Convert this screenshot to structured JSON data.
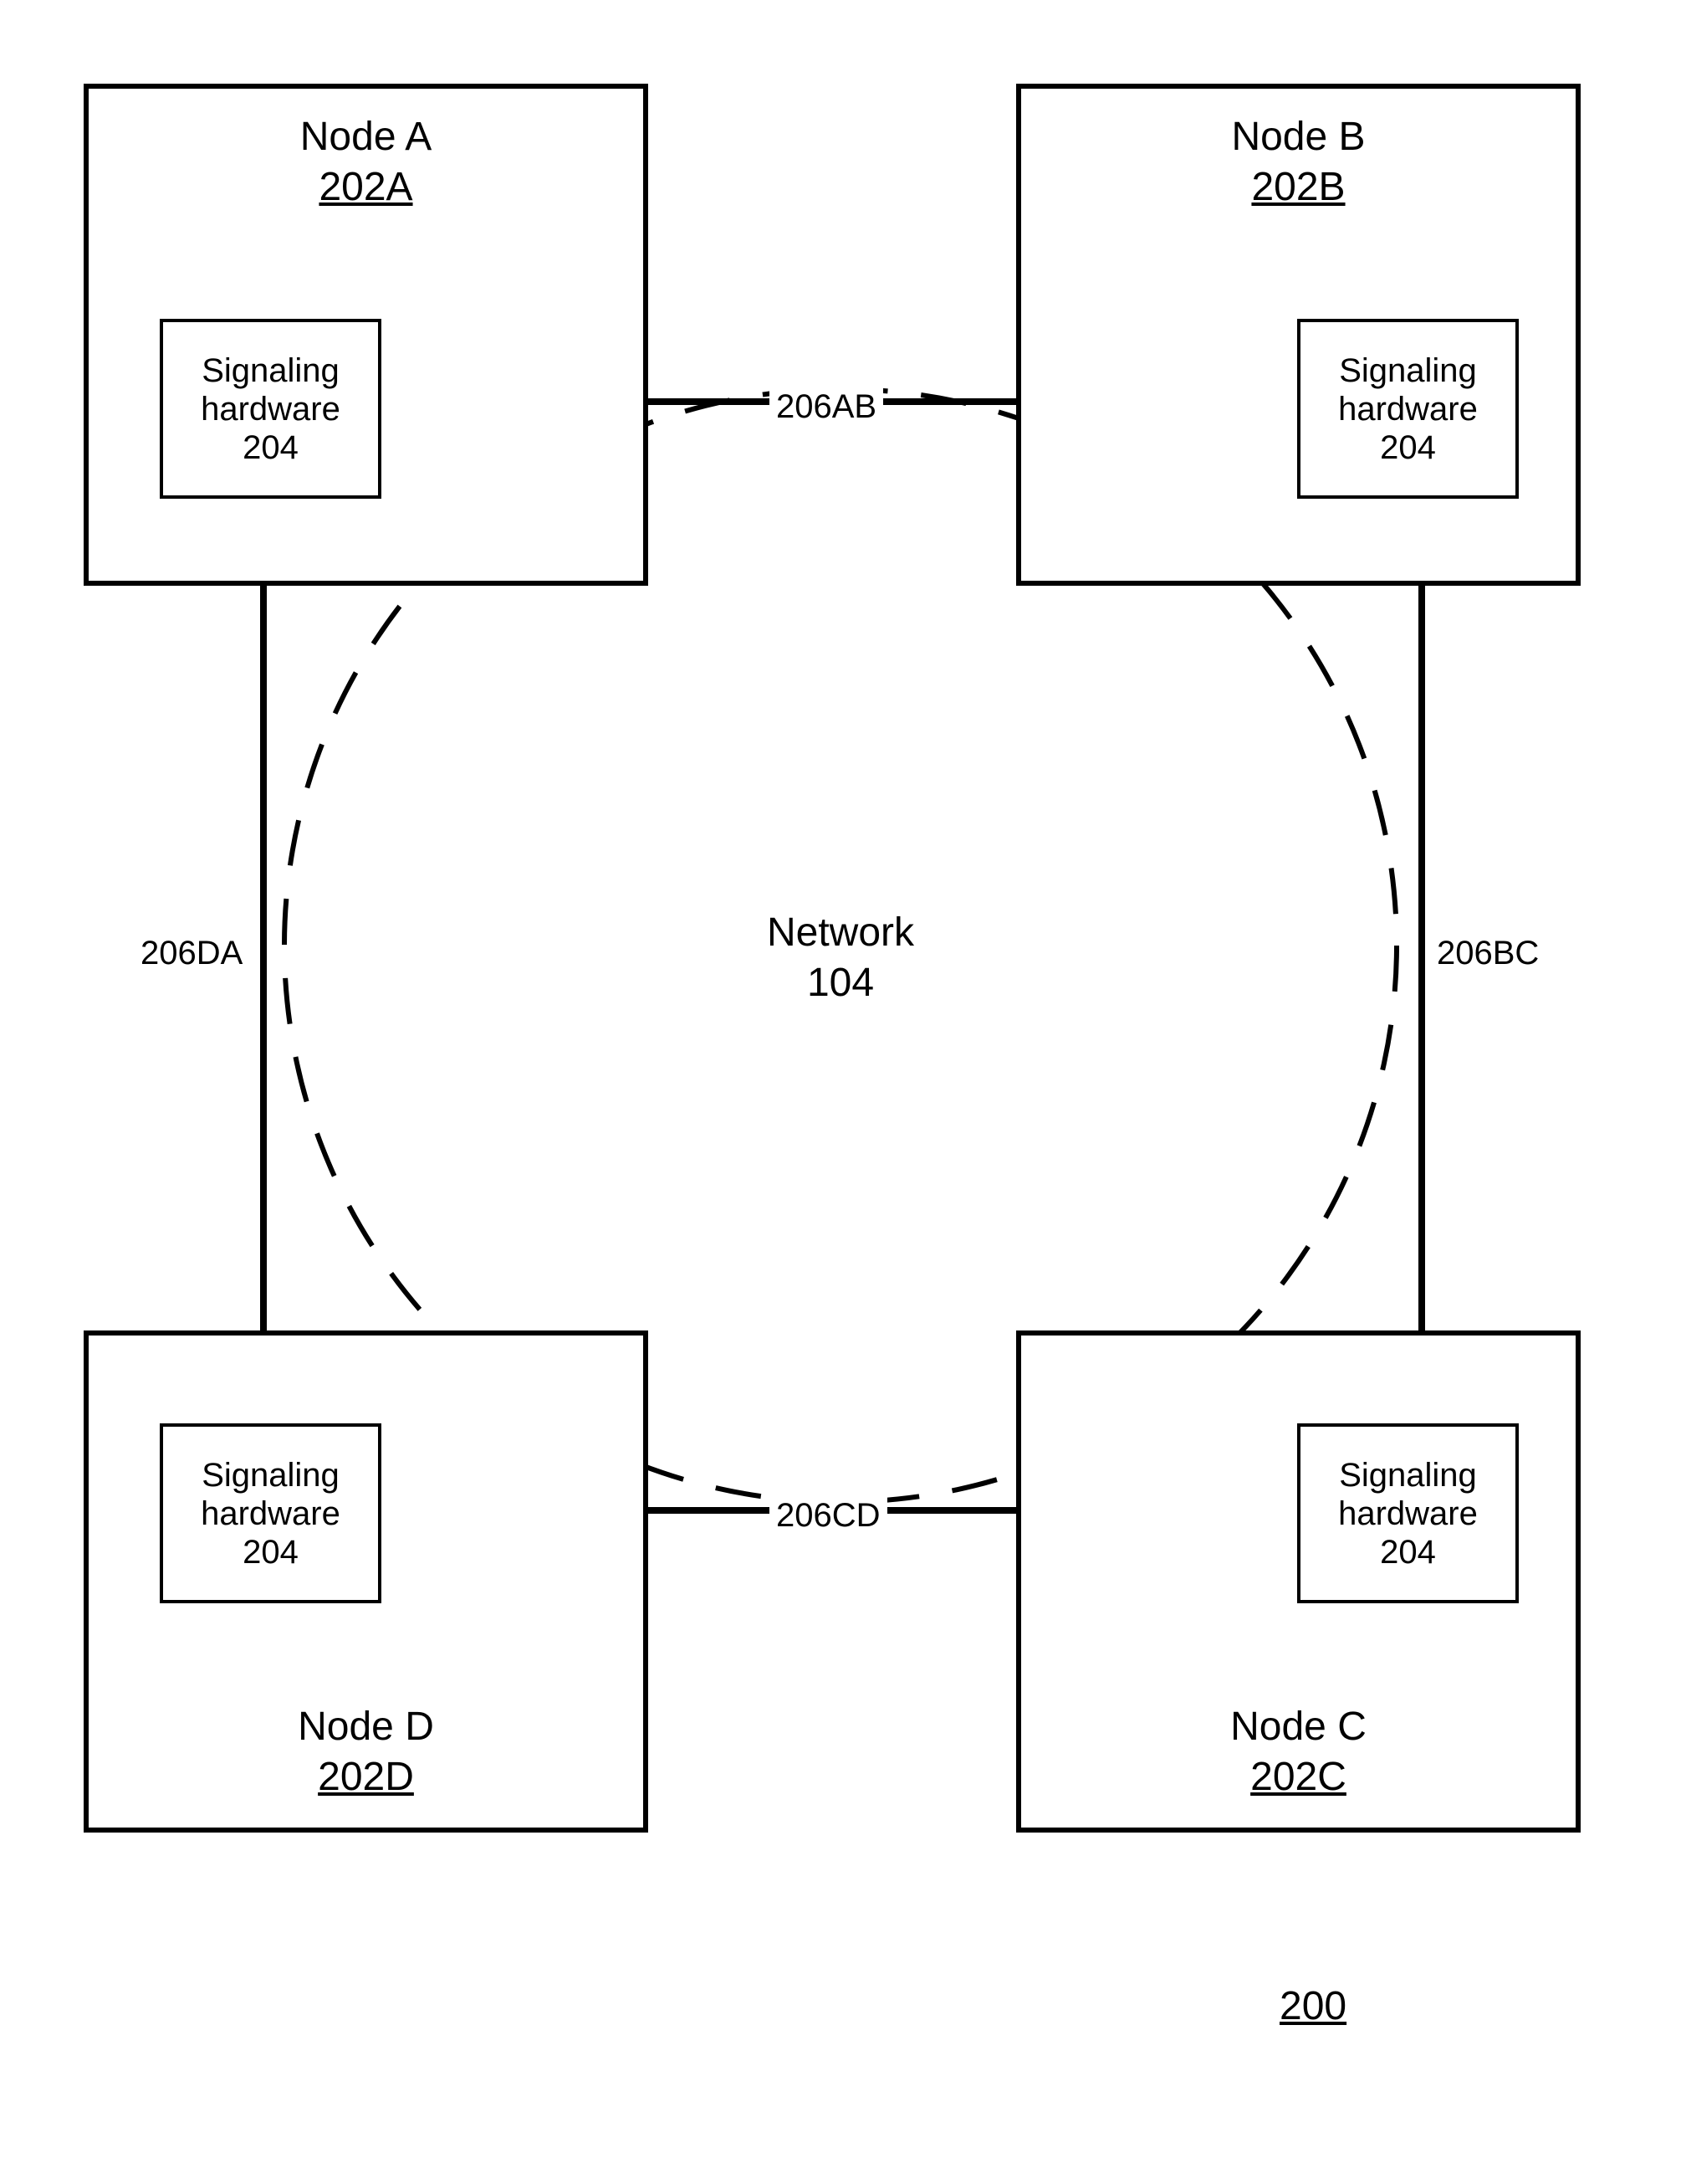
{
  "nodes": {
    "a": {
      "title": "Node A",
      "ref": "202A"
    },
    "b": {
      "title": "Node B",
      "ref": "202B"
    },
    "c": {
      "title": "Node C",
      "ref": "202C"
    },
    "d": {
      "title": "Node D",
      "ref": "202D"
    }
  },
  "signal": {
    "line1": "Signaling",
    "line2": "hardware",
    "ref": "204"
  },
  "network": {
    "name": "Network",
    "ref": "104"
  },
  "edges": {
    "ab": "206AB",
    "bc": "206BC",
    "cd": "206CD",
    "da": "206DA"
  },
  "figure_ref": "200"
}
